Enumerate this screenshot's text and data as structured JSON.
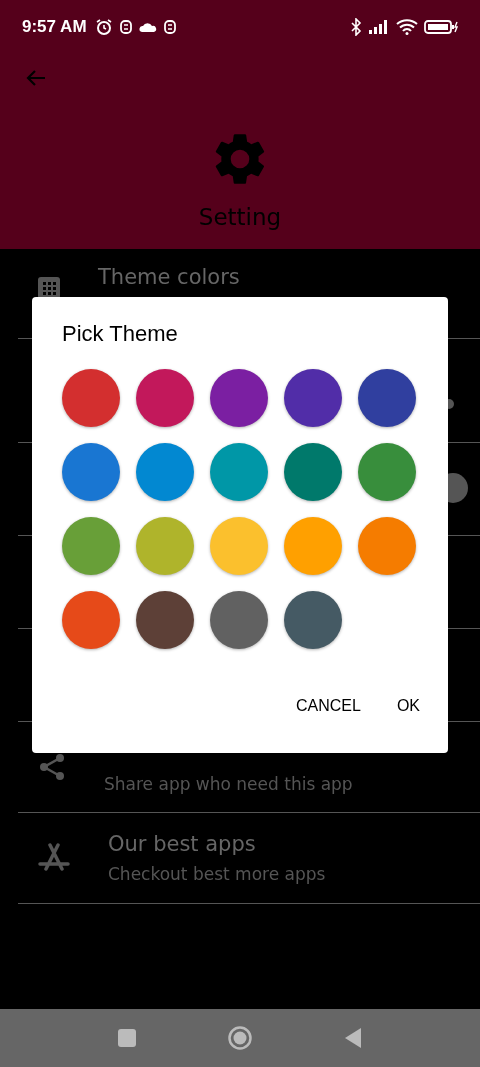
{
  "status_bar": {
    "time": "9:57 AM"
  },
  "header": {
    "title": "Setting"
  },
  "settings": [
    {
      "title": "Theme colors"
    },
    {
      "subtitle": "Share app who need this app"
    },
    {
      "title": "Our best apps",
      "subtitle": "Checkout best more apps"
    }
  ],
  "dialog": {
    "title": "Pick Theme",
    "swatches": [
      {
        "color": "#d32f2f"
      },
      {
        "color": "#c2185b"
      },
      {
        "color": "#7b1fa2"
      },
      {
        "color": "#512da8"
      },
      {
        "color": "#303f9f"
      },
      {
        "color": "#1976d2"
      },
      {
        "color": "#0288d1"
      },
      {
        "color": "#0097a7"
      },
      {
        "color": "#00796b"
      },
      {
        "color": "#388e3c"
      },
      {
        "color": "#689f38"
      },
      {
        "color": "#afb42b"
      },
      {
        "color": "#fbc02d"
      },
      {
        "color": "#ffa000"
      },
      {
        "color": "#f57c00"
      },
      {
        "color": "#e64a19"
      },
      {
        "color": "#5d4037"
      },
      {
        "color": "#616161"
      },
      {
        "color": "#455a64"
      }
    ],
    "buttons": [
      "CANCEL",
      "OK"
    ]
  }
}
